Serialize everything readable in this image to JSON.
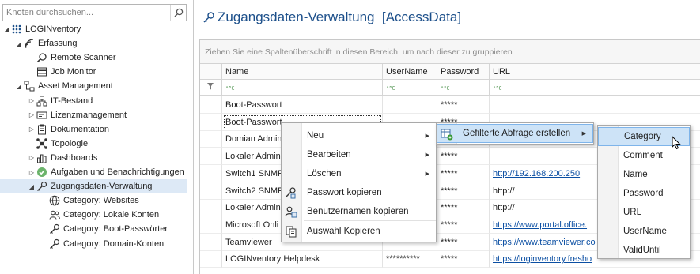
{
  "nav": {
    "search_placeholder": "Knoten durchsuchen...",
    "tree": [
      {
        "id": "root",
        "label": "LOGINventory",
        "icon": "grid-dots-icon",
        "indent": 0,
        "expander": "◢"
      },
      {
        "id": "erfassung",
        "label": "Erfassung",
        "icon": "wifi-signal-icon",
        "indent": 1,
        "expander": "◢"
      },
      {
        "id": "remote-scanner",
        "label": "Remote Scanner",
        "icon": "magnifier-icon",
        "indent": 2,
        "expander": ""
      },
      {
        "id": "job-monitor",
        "label": "Job Monitor",
        "icon": "server-icon",
        "indent": 2,
        "expander": ""
      },
      {
        "id": "asset-management",
        "label": "Asset Management",
        "icon": "hierarchy-icon",
        "indent": 1,
        "expander": "◢"
      },
      {
        "id": "it-bestand",
        "label": "IT-Bestand",
        "icon": "network-icon",
        "indent": 2,
        "expander": "▷"
      },
      {
        "id": "lizenzmanagement",
        "label": "Lizenzmanagement",
        "icon": "license-icon",
        "indent": 2,
        "expander": "▷"
      },
      {
        "id": "dokumentation",
        "label": "Dokumentation",
        "icon": "clipboard-icon",
        "indent": 2,
        "expander": "▷"
      },
      {
        "id": "topologie",
        "label": "Topologie",
        "icon": "topology-icon",
        "indent": 2,
        "expander": ""
      },
      {
        "id": "dashboards",
        "label": "Dashboards",
        "icon": "bar-chart-icon",
        "indent": 2,
        "expander": "▷"
      },
      {
        "id": "aufgaben",
        "label": "Aufgaben und Benachrichtigungen",
        "icon": "check-circle-icon",
        "indent": 2,
        "expander": "▷"
      },
      {
        "id": "zugangsdaten",
        "label": "Zugangsdaten-Verwaltung",
        "icon": "key-icon",
        "indent": 2,
        "expander": "◢",
        "selected": true
      },
      {
        "id": "cat-websites",
        "label": "Category: Websites",
        "icon": "globe-icon",
        "indent": 3,
        "expander": ""
      },
      {
        "id": "cat-lokale",
        "label": "Category: Lokale Konten",
        "icon": "users-icon",
        "indent": 3,
        "expander": ""
      },
      {
        "id": "cat-boot",
        "label": "Category: Boot-Passwörter",
        "icon": "key-icon",
        "indent": 3,
        "expander": ""
      },
      {
        "id": "cat-domain",
        "label": "Category: Domain-Konten",
        "icon": "key-icon",
        "indent": 3,
        "expander": ""
      }
    ]
  },
  "main": {
    "title": "Zugangsdaten-Verwaltung  [AccessData]",
    "group_panel_text": "Ziehen Sie eine Spaltenüberschrift in diesen Bereich, um nach dieser zu gruppieren",
    "columns": [
      "Name",
      "UserName",
      "Password",
      "URL"
    ],
    "filter_token": "ᴬᴮC",
    "rows": [
      {
        "name": "Boot-Passwort",
        "username": "",
        "password": "*****",
        "url": ""
      },
      {
        "name": "Boot-Passwort",
        "username": "",
        "password": "*****",
        "url": ""
      },
      {
        "name": "Domian Admin",
        "username": "",
        "password": "",
        "url": ""
      },
      {
        "name": "Lokaler Admin",
        "username": "",
        "password": "*****",
        "url": ""
      },
      {
        "name": "Switch1 SNMP",
        "username": "",
        "password": "*****",
        "url": "http://192.168.200.250"
      },
      {
        "name": "Switch2 SNMP",
        "username": "",
        "password": "*****",
        "url": "http://"
      },
      {
        "name": "Lokaler Admin",
        "username": "",
        "password": "*****",
        "url": "http://"
      },
      {
        "name": "Microsoft Onli",
        "username": "",
        "password": "*****",
        "url": "https://www.portal.office."
      },
      {
        "name": "Teamviewer",
        "username": "",
        "password": "*****",
        "url": "https://www.teamviewer.co"
      },
      {
        "name": "LOGINventory Helpdesk",
        "username": "**********",
        "password": "*****",
        "url": "https://loginventory.fresho"
      }
    ]
  },
  "context_menu": {
    "items": [
      {
        "label": "Neu",
        "icon": "",
        "submenu": true
      },
      {
        "label": "Bearbeiten",
        "icon": "",
        "submenu": true
      },
      {
        "label": "Löschen",
        "icon": "",
        "submenu": true
      },
      {
        "label": "Passwort kopieren",
        "icon": "key-copy-icon",
        "submenu": false
      },
      {
        "label": "Benutzernamen kopieren",
        "icon": "user-copy-icon",
        "submenu": false
      },
      {
        "label": "Auswahl Kopieren",
        "icon": "copy-icon",
        "submenu": false
      }
    ]
  },
  "submenu": {
    "items": [
      {
        "label": "Gefilterte Abfrage erstellen",
        "icon": "filtered-query-icon",
        "submenu": true
      }
    ]
  },
  "field_menu": {
    "items": [
      "Category",
      "Comment",
      "Name",
      "Password",
      "URL",
      "UserName",
      "ValidUntil"
    ]
  },
  "colors": {
    "accent": "#1c4f8a",
    "highlight": "#cde3f7",
    "selection": "#dde9f6",
    "link": "#0b4fa3"
  }
}
